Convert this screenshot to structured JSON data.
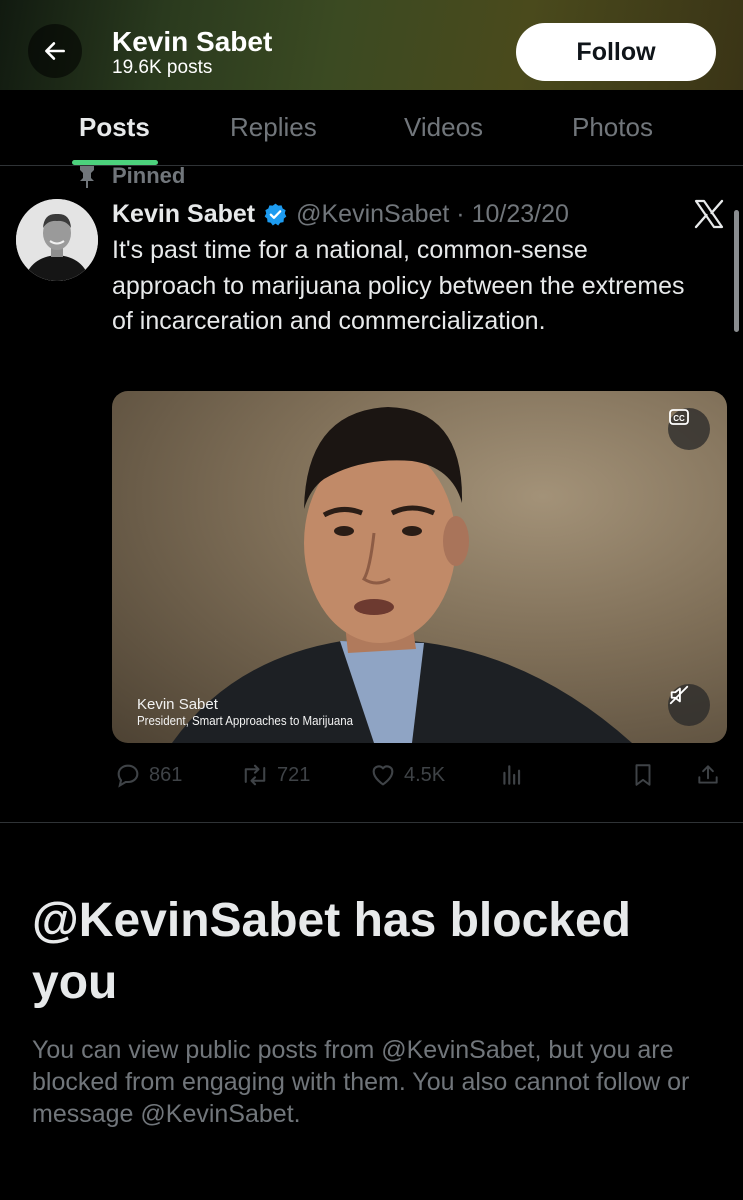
{
  "header": {
    "name": "Kevin Sabet",
    "post_count": "19.6K posts",
    "follow_label": "Follow"
  },
  "tabs": [
    {
      "label": "Posts",
      "active": true
    },
    {
      "label": "Replies",
      "active": false
    },
    {
      "label": "Videos",
      "active": false
    },
    {
      "label": "Photos",
      "active": false
    }
  ],
  "tweet": {
    "pinned_label": "Pinned",
    "author_name": "Kevin Sabet",
    "handle": "@KevinSabet",
    "date": "10/23/20",
    "text": "It's past time for a national, common-sense approach to marijuana policy between the extremes of incarceration and commercialization.",
    "video": {
      "caption_name": "Kevin Sabet",
      "caption_title": "President, Smart Approaches to Marijuana"
    },
    "replies": "861",
    "reposts": "721",
    "likes": "4.5K"
  },
  "blocked": {
    "title": "@KevinSabet has blocked you",
    "body": "You can view public posts from @KevinSabet, but you are blocked from engaging with them. You also cannot follow or message @KevinSabet."
  },
  "colors": {
    "accent_tab": "#4cd17c",
    "verified": "#1d9bf0",
    "muted_text": "#71767b"
  }
}
